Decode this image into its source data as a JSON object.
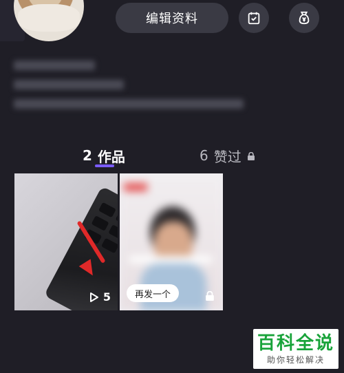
{
  "header": {
    "edit_profile_label": "编辑资料",
    "icons": [
      "calendar-check-icon",
      "money-bag-icon"
    ]
  },
  "tabs": {
    "works_count": "2",
    "works_label": "作品",
    "liked_count": "6",
    "liked_label": "赞过",
    "active": "works",
    "accent_color": "#7b5cff"
  },
  "videos": [
    {
      "play_count": "5",
      "icon": "play-icon"
    },
    {
      "repost_label": "再发一个",
      "icon": "lock-icon"
    }
  ],
  "watermark": {
    "title": "百科全说",
    "subtitle": "助你轻松解决",
    "title_color": "#19a33a"
  }
}
